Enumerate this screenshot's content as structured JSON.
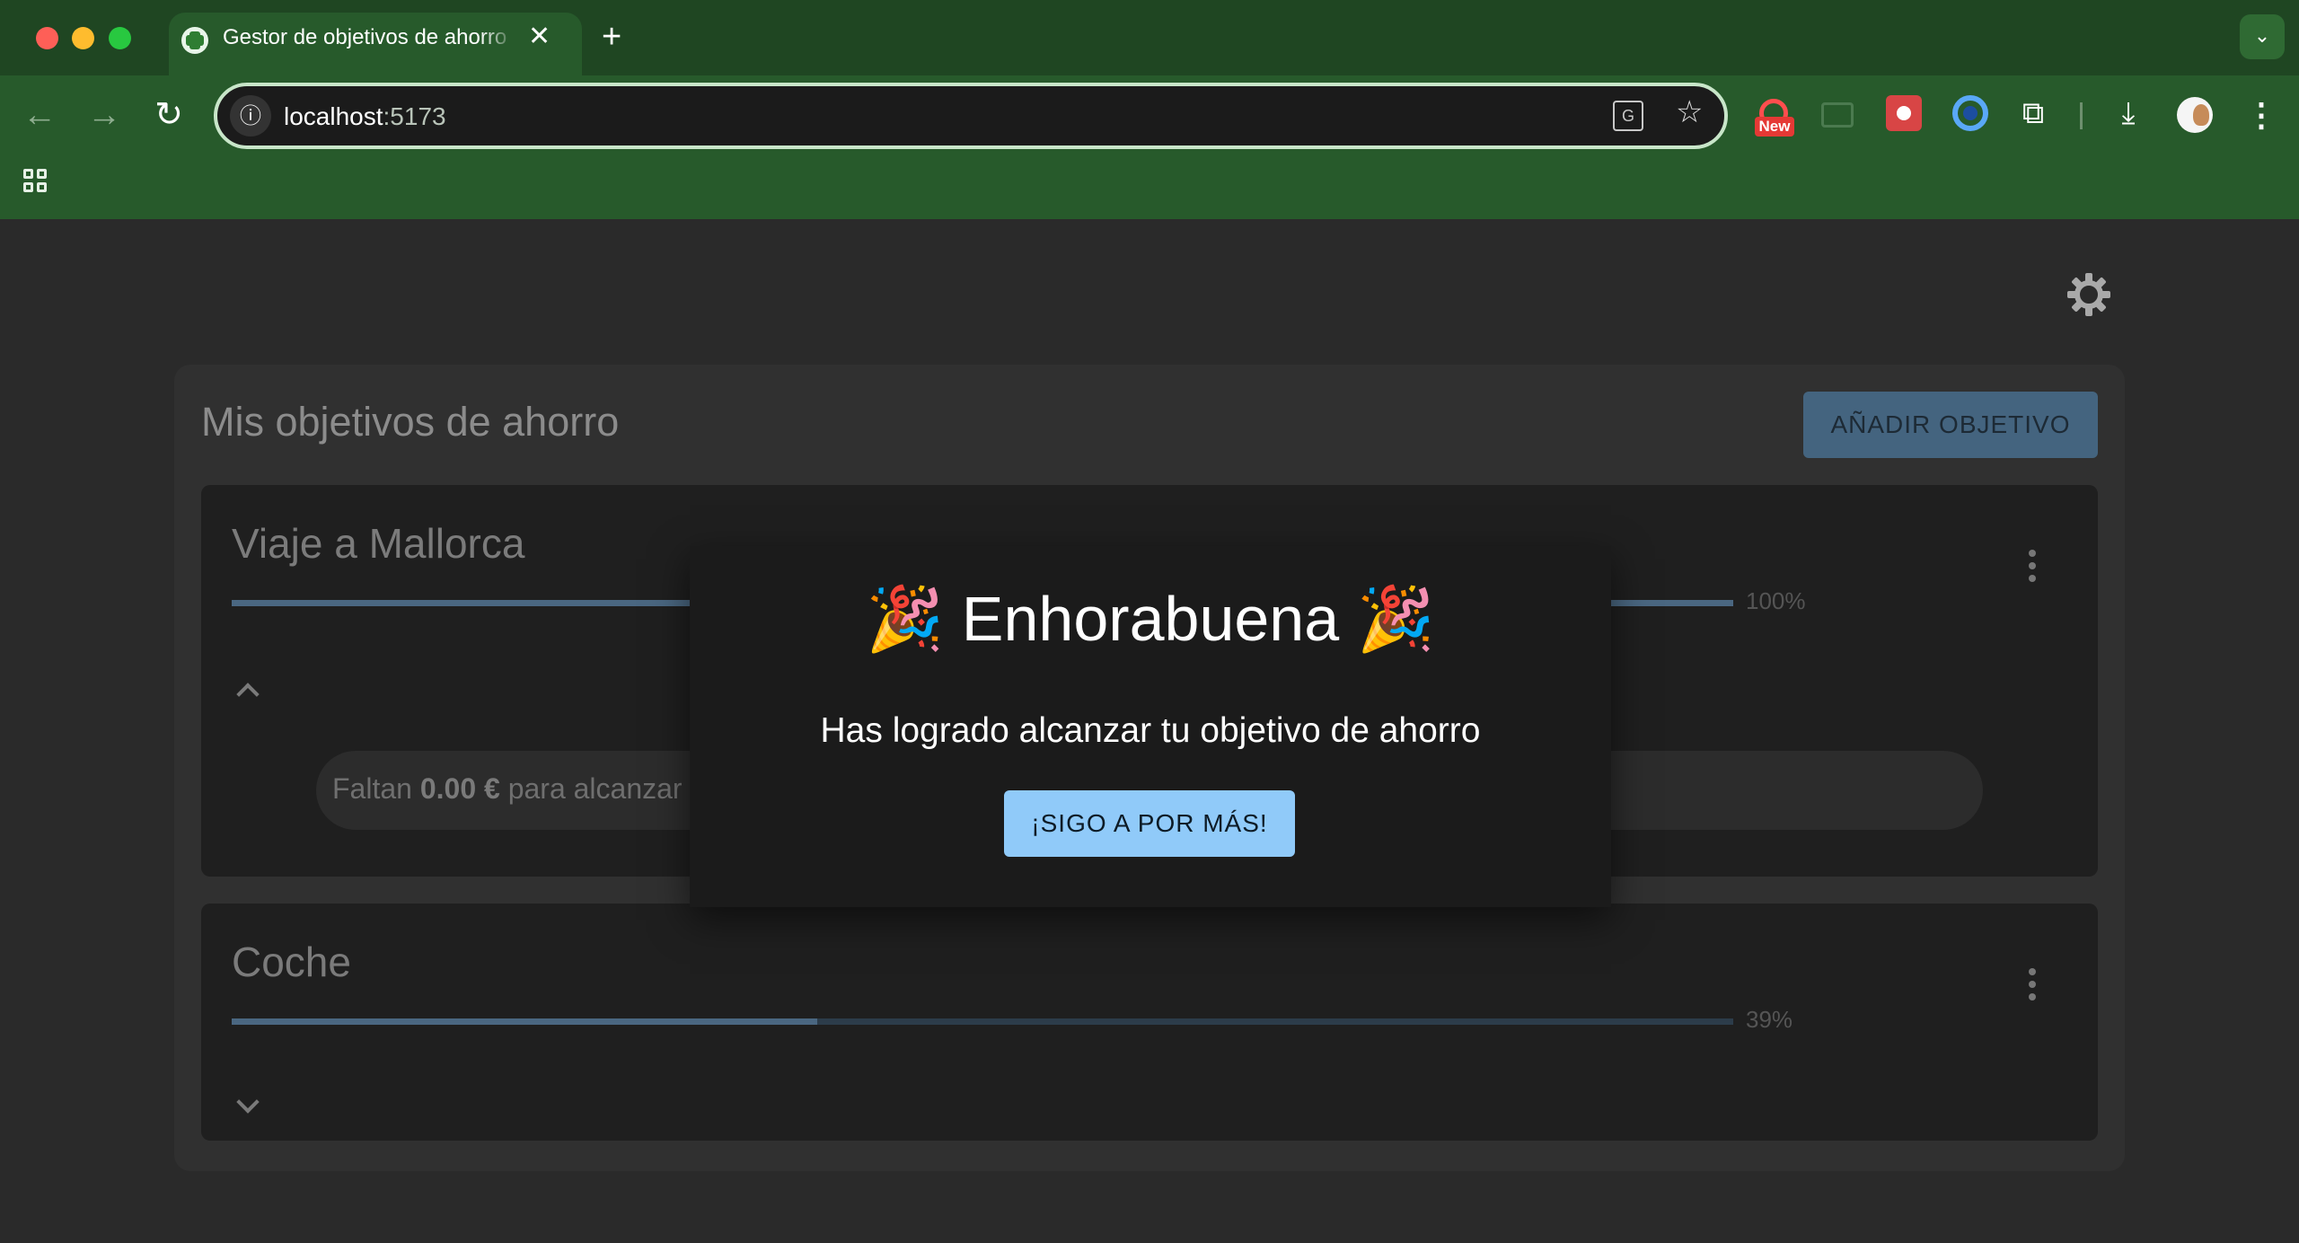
{
  "browser": {
    "tab_title": "Gestor de objetivos de ahorro",
    "tab_close": "✕",
    "new_tab": "+",
    "url_host": "localhost",
    "url_port": ":5173",
    "ext_badge": "New",
    "icons": [
      "back-arrow-icon",
      "forward-arrow-icon",
      "reload-icon",
      "site-info-icon",
      "translate-icon",
      "star-icon",
      "extension-new-icon",
      "extension-frame-icon",
      "extension-red-icon",
      "extension-circle-icon",
      "extensions-puzzle-icon",
      "download-icon",
      "profile-avatar",
      "menu-icon",
      "apps-icon"
    ],
    "colors": {
      "tabstrip": "#1f4622",
      "toolbar": "#275a2b"
    }
  },
  "page": {
    "title": "Mis objetivos de ahorro",
    "add_button": "AÑADIR OBJETIVO",
    "theme_icon": "brightness-icon",
    "goals": [
      {
        "name": "Viaje a Mallorca",
        "progress_percent": 100,
        "percent_label": "100%",
        "expanded": true,
        "remaining_prefix": "Faltan",
        "remaining_amount": "0.00 €",
        "remaining_suffix": "para alcanzar tu objetivo de ahorro"
      },
      {
        "name": "Coche",
        "progress_percent": 39,
        "percent_label": "39%",
        "expanded": false
      }
    ],
    "colors": {
      "accent": "#90caf9",
      "progress": "#4a6781"
    }
  },
  "modal": {
    "party_emoji": "🎉",
    "title": "Enhorabuena",
    "message": "Has logrado alcanzar tu objetivo de ahorro",
    "button": "¡SIGO A POR MÁS!"
  }
}
